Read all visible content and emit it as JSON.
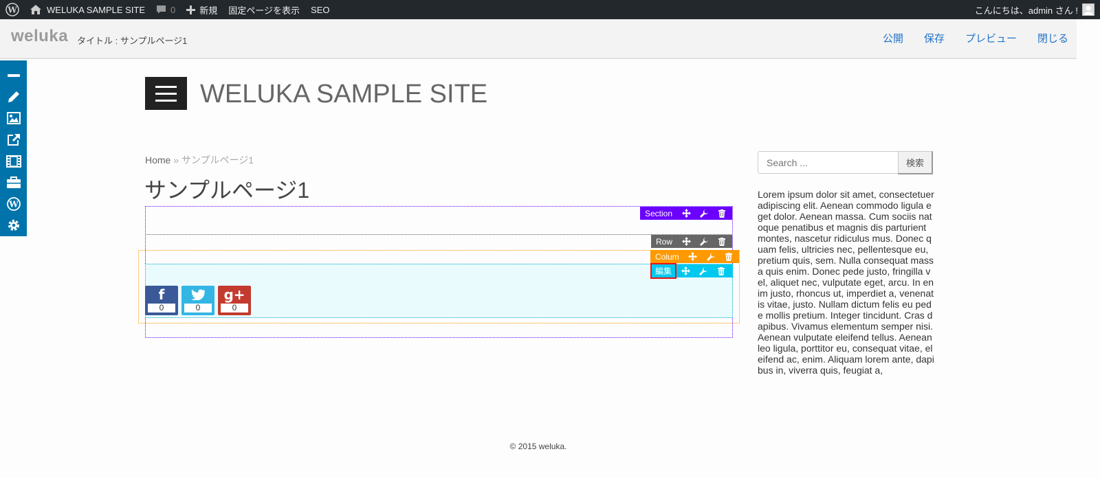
{
  "adminbar": {
    "site_name": "WELUKA SAMPLE SITE",
    "comments_count": "0",
    "new_label": "新規",
    "view_page_label": "固定ページを表示",
    "seo_label": "SEO",
    "greeting": "こんにちは、admin さん !"
  },
  "editor": {
    "brand": "weluka",
    "title_label": "タイトル : サンプルページ1",
    "actions": {
      "publish": "公開",
      "save": "保存",
      "preview": "プレビュー",
      "close": "閉じる"
    }
  },
  "tools": [
    "minus-icon",
    "pencil-icon",
    "image-icon",
    "external-link-icon",
    "film-icon",
    "briefcase-icon",
    "wordpress-icon",
    "gear-icon"
  ],
  "site": {
    "title": "WELUKA SAMPLE SITE"
  },
  "breadcrumb": {
    "home": "Home",
    "separator": "»",
    "current": "サンプルページ1"
  },
  "page": {
    "title": "サンプルページ1"
  },
  "builder": {
    "section_label": "Section",
    "row_label": "Row",
    "colum_label": "Colum",
    "edit_label": "編集",
    "colors": {
      "section": "#6b00ff",
      "row": "#666666",
      "colum": "#ff9900",
      "module": "#00c8ee",
      "selected": "#ee1111"
    }
  },
  "share": [
    {
      "network": "facebook",
      "glyph": "f",
      "count": "0"
    },
    {
      "network": "twitter",
      "glyph": "twitter-bird-icon",
      "count": "0"
    },
    {
      "network": "google-plus",
      "glyph": "g+",
      "count": "0"
    }
  ],
  "sidebar": {
    "search_placeholder": "Search ...",
    "search_button": "検索",
    "text": "Lorem ipsum dolor sit amet, consectetuer adipiscing elit. Aenean commodo ligula eget dolor. Aenean massa. Cum sociis natoque penatibus et magnis dis parturient montes, nascetur ridiculus mus. Donec quam felis, ultricies nec, pellentesque eu, pretium quis, sem. Nulla consequat massa quis enim. Donec pede justo, fringilla vel, aliquet nec, vulputate eget, arcu. In enim justo, rhoncus ut, imperdiet a, venenatis vitae, justo. Nullam dictum felis eu pede mollis pretium. Integer tincidunt. Cras dapibus. Vivamus elementum semper nisi. Aenean vulputate eleifend tellus. Aenean leo ligula, porttitor eu, consequat vitae, eleifend ac, enim. Aliquam lorem ante, dapibus in, viverra quis, feugiat a,"
  },
  "footer": {
    "copyright": "© 2015 weluka."
  }
}
